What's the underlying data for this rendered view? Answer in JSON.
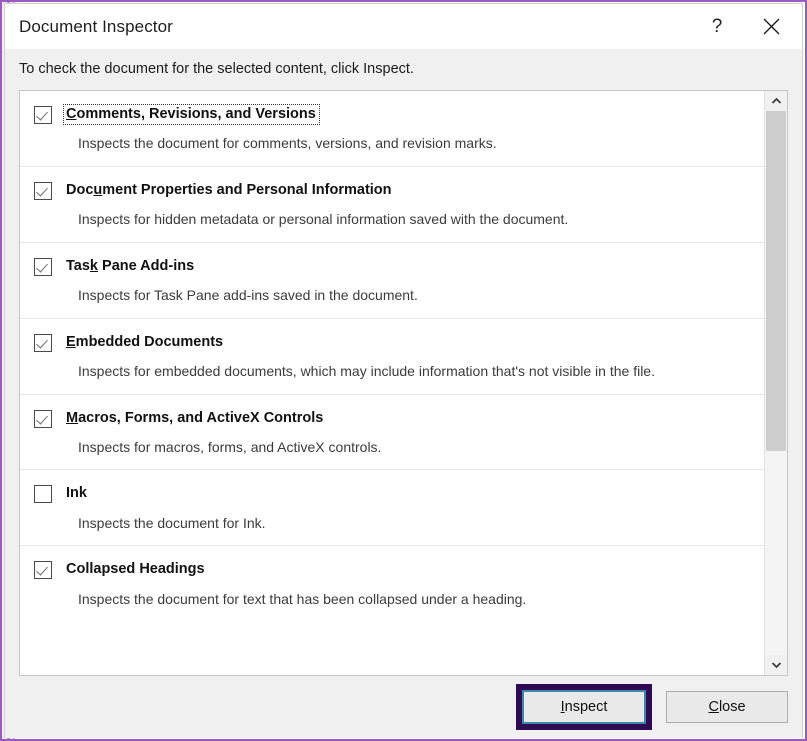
{
  "window": {
    "title": "Document Inspector",
    "help_icon": "question-mark-icon",
    "close_icon": "close-x-icon"
  },
  "instruction": "To check the document for the selected content, click Inspect.",
  "list": {
    "items": [
      {
        "label_pre": "",
        "accel": "C",
        "label_post": "omments, Revisions, and Versions",
        "full_label": "Comments, Revisions, and Versions",
        "description": "Inspects the document for comments, versions, and revision marks.",
        "checked": true,
        "focused": true
      },
      {
        "label_pre": "Doc",
        "accel": "u",
        "label_post": "ment Properties and Personal Information",
        "full_label": "Document Properties and Personal Information",
        "description": "Inspects for hidden metadata or personal information saved with the document.",
        "checked": true,
        "focused": false
      },
      {
        "label_pre": "Tas",
        "accel": "k",
        "label_post": " Pane Add-ins",
        "full_label": "Task Pane Add-ins",
        "description": "Inspects for Task Pane add-ins saved in the document.",
        "checked": true,
        "focused": false
      },
      {
        "label_pre": "",
        "accel": "E",
        "label_post": "mbedded Documents",
        "full_label": "Embedded Documents",
        "description": "Inspects for embedded documents, which may include information that's not visible in the file.",
        "checked": true,
        "focused": false
      },
      {
        "label_pre": "",
        "accel": "M",
        "label_post": "acros, Forms, and ActiveX Controls",
        "full_label": "Macros, Forms, and ActiveX Controls",
        "description": "Inspects for macros, forms, and ActiveX controls.",
        "checked": true,
        "focused": false
      },
      {
        "label_pre": "Ink",
        "accel": "",
        "label_post": "",
        "full_label": "Ink",
        "description": "Inspects the document for Ink.",
        "checked": false,
        "focused": false
      },
      {
        "label_pre": "Collapsed Headings",
        "accel": "",
        "label_post": "",
        "full_label": "Collapsed Headings",
        "description": "Inspects the document for text that has been collapsed under a heading.",
        "checked": true,
        "focused": false
      }
    ],
    "scrollbar": {
      "up_arrow_icon": "chevron-up-icon",
      "down_arrow_icon": "chevron-down-icon",
      "thumb_position_pct": 0,
      "thumb_size_pct": 62
    }
  },
  "footer": {
    "inspect": {
      "pre": "",
      "accel": "I",
      "post": "nspect",
      "full": "Inspect"
    },
    "close": {
      "pre": "",
      "accel": "C",
      "post": "lose",
      "full": "Close"
    }
  },
  "colors": {
    "annotation_highlight": "#2d0a52",
    "annotation_frame": "#9b59c4",
    "focus_ring": "#3d87ad",
    "dialog_chrome": "#f0f0f0",
    "list_background": "#ffffff"
  }
}
